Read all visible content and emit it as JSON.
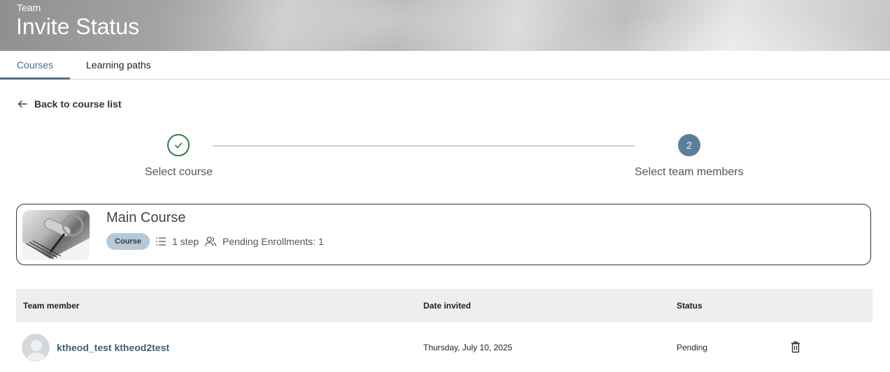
{
  "header": {
    "eyebrow": "Team",
    "title": "Invite Status"
  },
  "tabs": [
    {
      "label": "Courses",
      "active": true
    },
    {
      "label": "Learning paths",
      "active": false
    }
  ],
  "back_link": {
    "label": "Back to course list",
    "icon": "arrow-left-icon"
  },
  "stepper": {
    "steps": [
      {
        "label": "Select course",
        "state": "completed",
        "icon": "check-icon"
      },
      {
        "label": "Select team members",
        "state": "active",
        "number": "2"
      }
    ],
    "colors": {
      "completed": "#2e7d46",
      "active": "#5c7f97"
    }
  },
  "course": {
    "title": "Main Course",
    "badge": "Course",
    "steps": "1 step",
    "pending": "Pending Enrollments: 1"
  },
  "table": {
    "columns": [
      "Team member",
      "Date invited",
      "Status"
    ],
    "rows": [
      {
        "member": "ktheod_test ktheod2test",
        "date": "Thursday, July 10, 2025",
        "status": "Pending"
      }
    ]
  },
  "colors": {
    "accent": "#4e6f85",
    "link": "#3e5f74",
    "header_bg": "#eceef0"
  }
}
